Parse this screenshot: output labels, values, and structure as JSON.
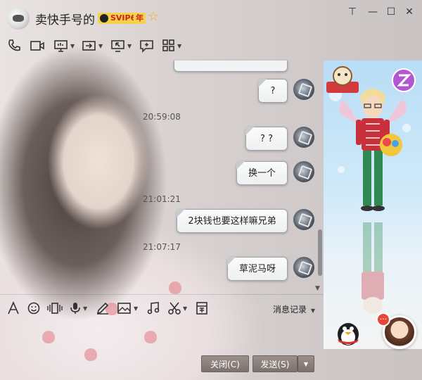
{
  "window": {
    "nickname": "卖快手号的",
    "svip_label": "SVIP6",
    "year_badge": "年",
    "controls": {
      "minimize": "—",
      "maximize": "☐",
      "close": "✕",
      "pin": "⊤"
    }
  },
  "action_toolbar": [
    {
      "name": "phone-icon",
      "glyph": "✆"
    },
    {
      "name": "video-icon",
      "glyph": "▣"
    },
    {
      "name": "remote-desktop-icon",
      "glyph": "▭"
    },
    {
      "name": "send-file-icon",
      "glyph": "⇥"
    },
    {
      "name": "screen-share-icon",
      "glyph": "◱"
    },
    {
      "name": "create-discussion-icon",
      "glyph": "⊕"
    },
    {
      "name": "apps-grid-icon",
      "glyph": "▦"
    }
  ],
  "messages": {
    "m1": "?",
    "t1": "20:59:08",
    "m2": "? ?",
    "m3": "换一个",
    "t2": "21:01:21",
    "m4": "2块钱也要这样嘛兄弟",
    "t3": "21:07:17",
    "m5": "草泥马呀"
  },
  "input_toolbar": {
    "tools": [
      "font-icon",
      "emoji-icon",
      "shake-icon",
      "voice-icon",
      "edit-icon",
      "image-icon",
      "music-icon",
      "screenshot-icon",
      "red-packet-icon"
    ],
    "history_label": "消息记录"
  },
  "buttons": {
    "close_label": "关闭(C)",
    "send_label": "发送(S)",
    "send_dropdown": "▼"
  },
  "colors": {
    "bubble_border": "#9ea5aa",
    "button_bg": "#8a7e7b",
    "svip_gold": "#f6d24a"
  }
}
